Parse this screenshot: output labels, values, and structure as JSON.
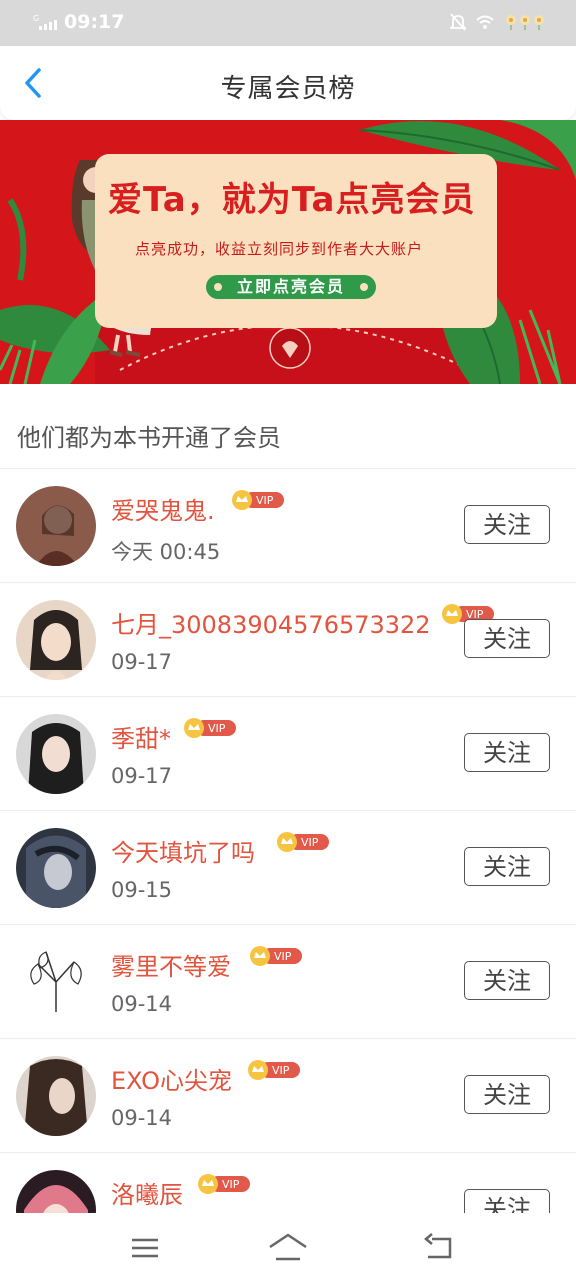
{
  "status_bar": {
    "time": "09:17"
  },
  "header": {
    "title": "专属会员榜"
  },
  "banner": {
    "headline": "爱Ta，就为Ta点亮会员",
    "subline": "点亮成功，收益立刻同步到作者大大账户",
    "cta": "立即点亮会员"
  },
  "section": {
    "title": "他们都为本书开通了会员"
  },
  "members": [
    {
      "name": "爱哭鬼鬼.",
      "date": "今天 00:45",
      "vip": "VIP",
      "follow": "关注",
      "avatar_color": "#8a5a4a"
    },
    {
      "name": "七月_30083904576573322",
      "date": "09-17",
      "vip": "VIP",
      "follow": "关注",
      "avatar_color": "#c9a894"
    },
    {
      "name": "季甜*",
      "date": "09-17",
      "vip": "VIP",
      "follow": "关注",
      "avatar_color": "#3a3a3a"
    },
    {
      "name": "今天填坑了吗",
      "date": "09-15",
      "vip": "VIP",
      "follow": "关注",
      "avatar_color": "#2e3440"
    },
    {
      "name": "雾里不等爱",
      "date": "09-14",
      "vip": "VIP",
      "follow": "关注",
      "avatar_color": "#ffffff"
    },
    {
      "name": "EXO心尖宠",
      "date": "09-14",
      "vip": "VIP",
      "follow": "关注",
      "avatar_color": "#b89a88"
    },
    {
      "name": "洛曦辰",
      "date": "",
      "vip": "VIP",
      "follow": "关注",
      "avatar_color": "#e07a8a"
    }
  ],
  "colors": {
    "accent_red": "#d4151a",
    "name_red": "#e2543e",
    "back_blue": "#2196f3",
    "vip_gold": "#f5c542"
  }
}
